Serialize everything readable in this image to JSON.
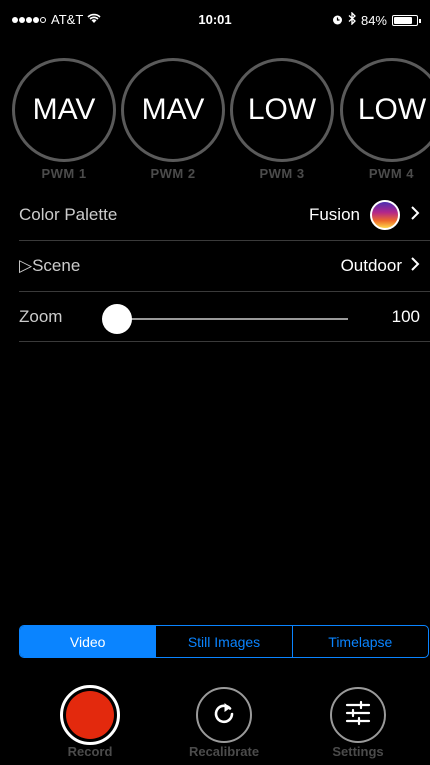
{
  "status_bar": {
    "carrier": "AT&T",
    "time": "10:01",
    "battery_percent": "84%",
    "battery_level": 0.84,
    "icons": [
      "signal-icon",
      "wifi-icon",
      "alarm-icon",
      "bluetooth-icon",
      "battery-icon"
    ]
  },
  "pwm": [
    {
      "value": "MAV",
      "label": "PWM 1"
    },
    {
      "value": "MAV",
      "label": "PWM 2"
    },
    {
      "value": "LOW",
      "label": "PWM 3"
    },
    {
      "value": "LOW",
      "label": "PWM 4"
    }
  ],
  "color_palette": {
    "label": "Color Palette",
    "value": "Fusion"
  },
  "scene": {
    "label": "▷Scene",
    "value": "Outdoor"
  },
  "zoom": {
    "label": "Zoom",
    "value": "100",
    "slider_fraction": 0.0
  },
  "modes": {
    "items": [
      "Video",
      "Still Images",
      "Timelapse"
    ],
    "selected": "Video"
  },
  "actions": {
    "record": "Record",
    "recalibrate": "Recalibrate",
    "settings": "Settings"
  },
  "colors": {
    "accent": "#0a84ff",
    "record": "#e3290d",
    "background": "#000000"
  }
}
